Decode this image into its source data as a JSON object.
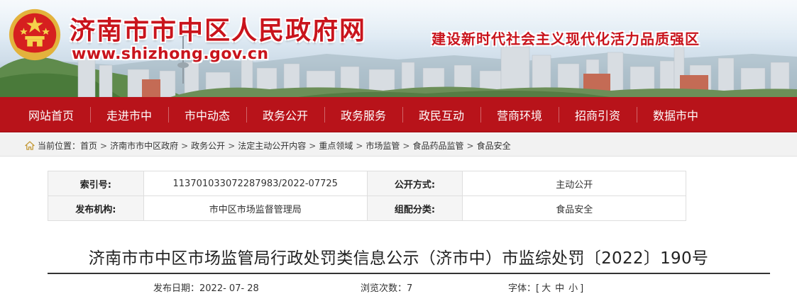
{
  "header": {
    "site_name": "济南市市中区人民政府网",
    "url": "www.shizhong.gov.cn",
    "slogan": "建设新时代社会主义现代化活力品质强区"
  },
  "nav": [
    "网站首页",
    "走进市中",
    "市中动态",
    "政务公开",
    "政务服务",
    "政民互动",
    "营商环境",
    "招商引资",
    "数据市中"
  ],
  "breadcrumb": {
    "prefix": "当前位置：",
    "items": [
      "首页",
      "济南市市中区政府",
      "政务公开",
      "法定主动公开内容",
      "重点领域",
      "市场监管",
      "食品药品监管",
      "食品安全"
    ],
    "separator": ">"
  },
  "meta": {
    "index_label": "索引号:",
    "index_value": "113701033072287983/2022-07725",
    "disclosure_label": "公开方式:",
    "disclosure_value": "主动公开",
    "publisher_label": "发布机构:",
    "publisher_value": "市中区市场监督管理局",
    "category_label": "组配分类:",
    "category_value": "食品安全"
  },
  "article": {
    "title": "济南市市中区市场监管局行政处罚类信息公示（济市中）市监综处罚〔2022〕190号",
    "date_label": "发布日期：",
    "date_value": "2022- 07- 28",
    "views_label": "浏览次数：",
    "views_value": "7",
    "fontsize_label": "字体：[",
    "fontsize_large": "大",
    "fontsize_medium": "中",
    "fontsize_small": "小",
    "fontsize_close": "]"
  },
  "colors": {
    "brand_red": "#c9141c",
    "nav_red": "#b8131a"
  },
  "icons": {
    "emblem": "national-emblem-icon",
    "home": "home-icon"
  }
}
